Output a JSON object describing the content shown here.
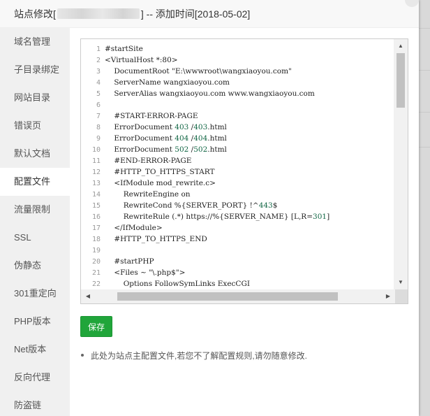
{
  "dialog": {
    "title_prefix": "站点修改[",
    "title_suffix": "] -- 添加时间[2018-05-02]"
  },
  "sidebar": {
    "items": [
      {
        "label": "域名管理"
      },
      {
        "label": "子目录绑定"
      },
      {
        "label": "网站目录"
      },
      {
        "label": "错误页"
      },
      {
        "label": "默认文档"
      },
      {
        "label": "配置文件",
        "active": true
      },
      {
        "label": "流量限制"
      },
      {
        "label": "SSL"
      },
      {
        "label": "伪静态"
      },
      {
        "label": "301重定向"
      },
      {
        "label": "PHP版本"
      },
      {
        "label": "Net版本"
      },
      {
        "label": "反向代理"
      },
      {
        "label": "防盗链"
      }
    ]
  },
  "editor": {
    "lines": [
      {
        "n": "1",
        "text": "#startSite"
      },
      {
        "n": "2",
        "text": "<VirtualHost *:80>"
      },
      {
        "n": "3",
        "text": "    DocumentRoot \"E:\\wwwroot\\wangxiaoyou.com\""
      },
      {
        "n": "4",
        "text": "    ServerName wangxiaoyou.com"
      },
      {
        "n": "5",
        "text": "    ServerAlias wangxiaoyou.com www.wangxiaoyou.com"
      },
      {
        "n": "6",
        "text": ""
      },
      {
        "n": "7",
        "text": "    #START-ERROR-PAGE"
      },
      {
        "n": "8",
        "text": "    ErrorDocument 403 /403.html"
      },
      {
        "n": "9",
        "text": "    ErrorDocument 404 /404.html"
      },
      {
        "n": "10",
        "text": "    ErrorDocument 502 /502.html"
      },
      {
        "n": "11",
        "text": "    #END-ERROR-PAGE"
      },
      {
        "n": "12",
        "text": "    #HTTP_TO_HTTPS_START"
      },
      {
        "n": "13",
        "text": "    <IfModule mod_rewrite.c>"
      },
      {
        "n": "14",
        "text": "        RewriteEngine on"
      },
      {
        "n": "15",
        "text": "        RewriteCond %{SERVER_PORT} !^443$"
      },
      {
        "n": "16",
        "text": "        RewriteRule (.*) https://%{SERVER_NAME} [L,R=301]"
      },
      {
        "n": "17",
        "text": "    </IfModule>"
      },
      {
        "n": "18",
        "text": "    #HTTP_TO_HTTPS_END"
      },
      {
        "n": "19",
        "text": ""
      },
      {
        "n": "20",
        "text": "    #startPHP"
      },
      {
        "n": "21",
        "text": "    <Files ~ \"\\.php$\">"
      },
      {
        "n": "22",
        "text": "        Options FollowSymLinks ExecCGI"
      }
    ]
  },
  "save_label": "保存",
  "note": "此处为站点主配置文件,若您不了解配置规则,请勿随意修改.",
  "colors": {
    "accent": "#20a53a",
    "number": "#116644"
  }
}
